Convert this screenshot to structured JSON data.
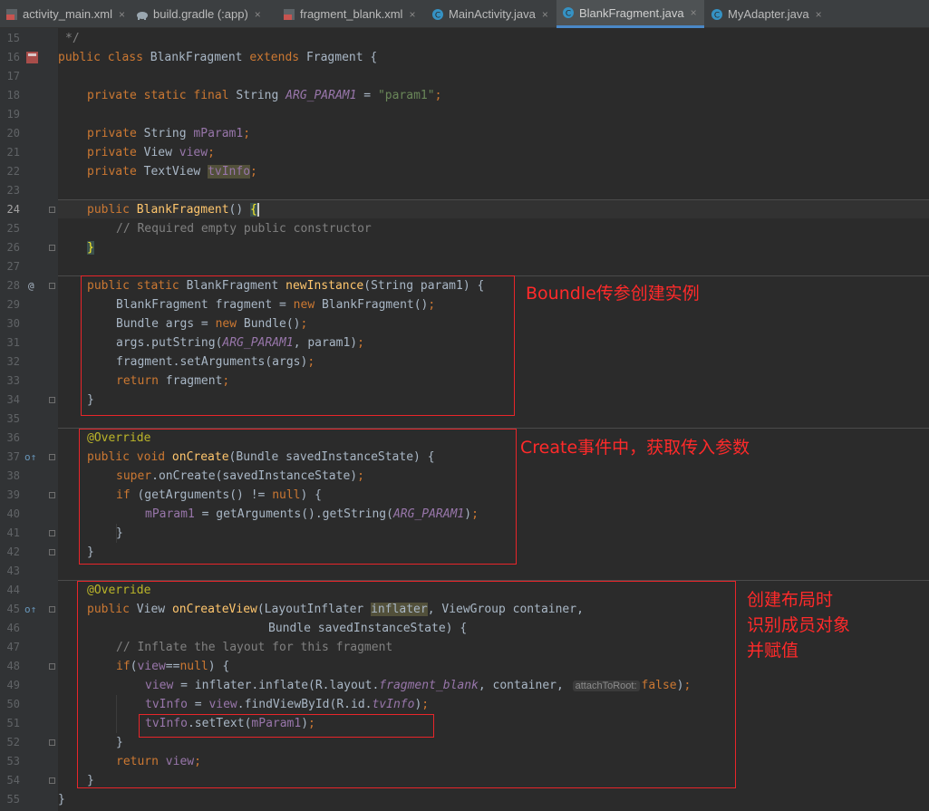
{
  "tabs": [
    {
      "label": "activity_main.xml",
      "icon": "xml-layout-icon",
      "close": "×"
    },
    {
      "label": "build.gradle (:app)",
      "icon": "gradle-elephant-icon",
      "close": "×"
    },
    {
      "label": "fragment_blank.xml",
      "icon": "xml-layout-icon",
      "close": "×"
    },
    {
      "label": "MainActivity.java",
      "icon": "java-class-icon",
      "close": "×"
    },
    {
      "label": "BlankFragment.java",
      "icon": "java-class-icon",
      "close": "×"
    },
    {
      "label": "MyAdapter.java",
      "icon": "java-class-icon",
      "close": "×"
    }
  ],
  "active_tab": "BlankFragment.java",
  "line_numbers": [
    "15",
    "16",
    "17",
    "18",
    "19",
    "20",
    "21",
    "22",
    "23",
    "24",
    "25",
    "26",
    "27",
    "28",
    "29",
    "30",
    "31",
    "32",
    "33",
    "34",
    "35",
    "36",
    "37",
    "38",
    "39",
    "40",
    "41",
    "42",
    "43",
    "44",
    "45",
    "46",
    "47",
    "48",
    "49",
    "50",
    "51",
    "52",
    "53",
    "54",
    "55"
  ],
  "current_line": "24",
  "gutter_icons": {
    "line_28": "@",
    "line_37": "o↑",
    "line_45": "o↑"
  },
  "code": {
    "l15": "*/",
    "l16": {
      "kw": "public class ",
      "name": "BlankFragment ",
      "kw2": "extends ",
      "rest": "Fragment {"
    },
    "l18": {
      "kw": "private static final ",
      "type": "String ",
      "field": "ARG_PARAM1",
      "eq": " = ",
      "str": "\"param1\"",
      "semi": ";"
    },
    "l20": {
      "kw": "private ",
      "type": "String ",
      "field": "mParam1",
      "semi": ";"
    },
    "l21": {
      "kw": "private ",
      "type": "View ",
      "field": "view",
      "semi": ";"
    },
    "l22": {
      "kw": "private ",
      "type": "TextView ",
      "field": "tvInfo",
      "semi": ";"
    },
    "l24": {
      "kw": "public ",
      "fn": "BlankFragment",
      "rest": "() ",
      "brace": "{"
    },
    "l25": "// Required empty public constructor",
    "l26": "}",
    "l28": {
      "kw": "public static ",
      "type": "BlankFragment ",
      "fn": "newInstance",
      "rest": "(String param1) {"
    },
    "l29": {
      "a": "BlankFragment fragment = ",
      "kw": "new ",
      "b": "BlankFragment()",
      "semi": ";"
    },
    "l30": {
      "a": "Bundle args = ",
      "kw": "new ",
      "b": "Bundle()",
      "semi": ";"
    },
    "l31": {
      "a": "args.putString(",
      "field": "ARG_PARAM1",
      "b": ", param1)",
      "semi": ";"
    },
    "l32": {
      "a": "fragment.setArguments(args)",
      "semi": ";"
    },
    "l33": {
      "kw": "return ",
      "a": "fragment",
      "semi": ";"
    },
    "l34": "}",
    "l36": "@Override",
    "l37": {
      "kw": "public void ",
      "fn": "onCreate",
      "rest": "(Bundle savedInstanceState) {"
    },
    "l38": {
      "kw": "super",
      "a": ".onCreate(savedInstanceState)",
      "semi": ";"
    },
    "l39": {
      "kw": "if ",
      "a": "(getArguments() != ",
      "kw2": "null",
      "b": ") {"
    },
    "l40": {
      "field": "mParam1",
      "a": " = getArguments().getString(",
      "sfield": "ARG_PARAM1",
      "b": ")",
      "semi": ";"
    },
    "l41": "}",
    "l42": "}",
    "l44": "@Override",
    "l45": {
      "kw": "public ",
      "type": "View ",
      "fn": "onCreateView",
      "a": "(LayoutInflater ",
      "param": "inflater",
      "b": ", ViewGroup container,"
    },
    "l46": "Bundle savedInstanceState) {",
    "l47": "// Inflate the layout for this fragment",
    "l48": {
      "kw": "if",
      "a": "(",
      "field": "view",
      "b": "==",
      "kw2": "null",
      "c": ") {"
    },
    "l49": {
      "field": "view",
      "a": " = inflater.inflate(R.layout.",
      "sfield": "fragment_blank",
      "b": ", container, ",
      "hint": "attachToRoot:",
      "kw": "false",
      "c": ")",
      "semi": ";"
    },
    "l50": {
      "field": "tvInfo",
      "a": " = ",
      "field2": "view",
      "b": ".findViewById(R.id.",
      "sfield": "tvInfo",
      "c": ")",
      "semi": ";"
    },
    "l51": {
      "field": "tvInfo",
      "a": ".setText(",
      "field2": "mParam1",
      "b": ")",
      "semi": ";"
    },
    "l52": "}",
    "l53": {
      "kw": "return ",
      "field": "view",
      "semi": ";"
    },
    "l54": "}",
    "l55": "}"
  },
  "annotations": {
    "note1": "Boundle传参创建实例",
    "note2": "Create事件中，获取传入参数",
    "note3": "创建布局时\n识别成员对象\n并赋值"
  },
  "colors": {
    "background": "#2b2b2b",
    "keyword": "#cc7832",
    "field": "#9876aa",
    "string": "#6a8759",
    "comment": "#808080",
    "method_decl": "#ffc66d",
    "annotation_meta": "#bbb529",
    "red_annotation": "#e8252a"
  }
}
